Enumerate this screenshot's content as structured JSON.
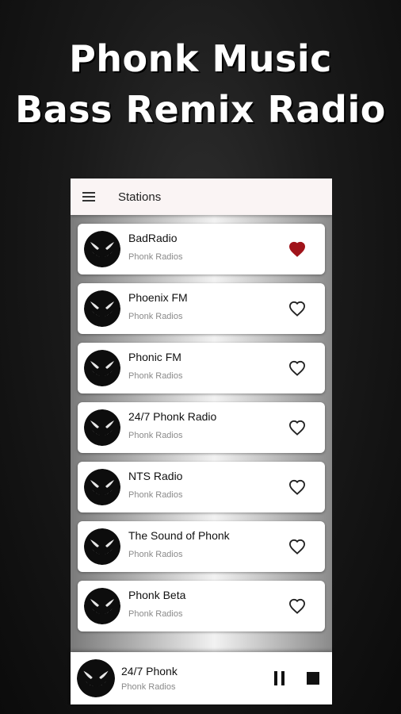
{
  "promo": {
    "line1": "Phonk Music",
    "line2": "Bass Remix Radio"
  },
  "app_bar": {
    "icon": "hamburger-menu-icon",
    "title": "Stations"
  },
  "stations": [
    {
      "name": "BadRadio",
      "genre": "Phonk Radios",
      "favorite": true
    },
    {
      "name": "Phoenix FM",
      "genre": "Phonk Radios",
      "favorite": false
    },
    {
      "name": "Phonic FM",
      "genre": "Phonk Radios",
      "favorite": false
    },
    {
      "name": "24/7 Phonk Radio",
      "genre": "Phonk Radios",
      "favorite": false
    },
    {
      "name": "NTS Radio",
      "genre": "Phonk Radios",
      "favorite": false
    },
    {
      "name": "The Sound of Phonk",
      "genre": "Phonk Radios",
      "favorite": false
    },
    {
      "name": "Phonk Beta",
      "genre": "Phonk Radios",
      "favorite": false
    }
  ],
  "player": {
    "title": "24/7 Phonk",
    "subtitle": "Phonk Radios",
    "pause_icon": "pause-icon",
    "stop_icon": "stop-icon"
  },
  "colors": {
    "favorite_active": "#a0131a",
    "app_bar": "#faf4f4"
  }
}
